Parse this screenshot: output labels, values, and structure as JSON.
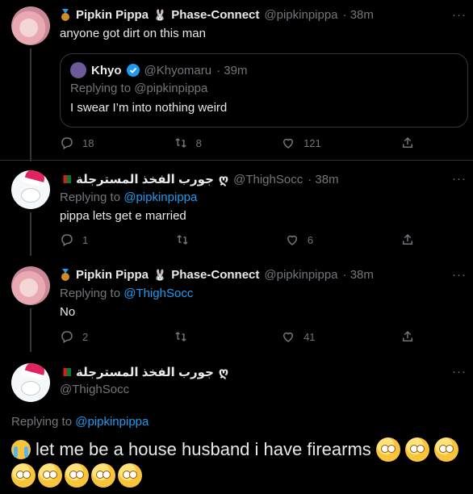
{
  "tweets": [
    {
      "name": "Pipkin Pippa",
      "extra": "Phase-Connect",
      "handle": "@pipkinpippa",
      "time": "· 38m",
      "text": "anyone got dirt on this man",
      "quote": {
        "name": "Khyo",
        "handle": "@Khyomaru",
        "time": "· 39m",
        "replying_label": "Replying to",
        "replying_to": "@pipkinpippa",
        "text": "I swear I’m into nothing weird"
      },
      "replies": "18",
      "retweets": "8",
      "likes": "121"
    },
    {
      "name": "جورب الفخذ المسترجلة",
      "name_suffix": "ღ",
      "handle": "@ThighSocc",
      "time": "· 38m",
      "replying_label": "Replying to",
      "replying_to": "@pipkinpippa",
      "text": "pippa lets get e married",
      "replies": "1",
      "retweets": "",
      "likes": "6"
    },
    {
      "name": "Pipkin Pippa",
      "extra": "Phase-Connect",
      "handle": "@pipkinpippa",
      "time": "· 38m",
      "replying_label": "Replying to",
      "replying_to": "@ThighSocc",
      "text": "No",
      "replies": "2",
      "retweets": "",
      "likes": "41"
    }
  ],
  "main": {
    "name": "جورب الفخذ المسترجلة",
    "name_suffix": "ღ",
    "handle": "@ThighSocc",
    "replying_label": "Replying to",
    "replying_to": "@pipkinpippa",
    "text": "let me be a house husband i have firearms",
    "lead_emoji": "crying-face",
    "trailing_emoji": "face-with-rolling-eyes",
    "trailing_count": 8
  },
  "more": "···",
  "colors": {
    "accent": "#1d9bf0",
    "muted": "#71767b",
    "bg": "#000000"
  }
}
